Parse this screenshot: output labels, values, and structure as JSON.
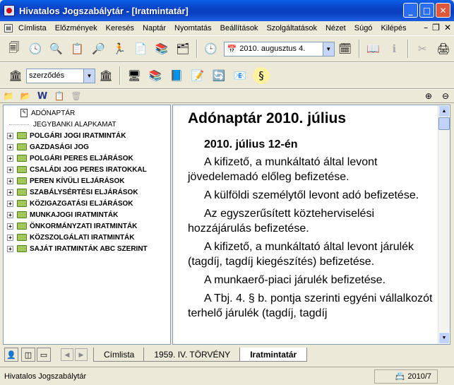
{
  "window": {
    "title": "Hivatalos Jogszabálytár - [Iratmintatár]",
    "minimize_label": "_",
    "maximize_label": "□",
    "close_label": "✕"
  },
  "menu": {
    "items": [
      "Címlista",
      "Előzmények",
      "Keresés",
      "Naptár",
      "Nyomtatás",
      "Beállítások",
      "Szolgáltatások",
      "Nézet",
      "Súgó",
      "Kilépés"
    ]
  },
  "toolbar1": {
    "date_value": "2010. augusztus 4."
  },
  "toolbar2": {
    "filter_value": "szerződés"
  },
  "tree": {
    "items": [
      {
        "label": "ADÓNAPTÁR",
        "type": "doc"
      },
      {
        "label": "JEGYBANKI ALAPKAMAT",
        "type": "leaf"
      },
      {
        "label": "POLGÁRI JOGI IRATMINTÁK",
        "type": "folder"
      },
      {
        "label": "GAZDASÁGI JOG",
        "type": "folder"
      },
      {
        "label": "POLGÁRI PERES ELJÁRÁSOK",
        "type": "folder"
      },
      {
        "label": "CSALÁDI JOG PERES IRATOKKAL",
        "type": "folder"
      },
      {
        "label": "PEREN KÍVÜLI ELJÁRÁSOK",
        "type": "folder"
      },
      {
        "label": "SZABÁLYSÉRTÉSI ELJÁRÁSOK",
        "type": "folder"
      },
      {
        "label": "KÖZIGAZGATÁSI ELJÁRÁSOK",
        "type": "folder"
      },
      {
        "label": "MUNKAJOGI IRATMINTÁK",
        "type": "folder"
      },
      {
        "label": "ÖNKORMÁNYZATI IRATMINTÁK",
        "type": "folder"
      },
      {
        "label": "KÖZSZOLGÁLATI IRATMINTÁK",
        "type": "folder"
      },
      {
        "label": "SAJÁT IRATMINTÁK ABC SZERINT",
        "type": "folder"
      }
    ]
  },
  "content": {
    "title": "Adónaptár 2010. július",
    "subtitle": "2010. július 12-én",
    "paragraphs": [
      "A kifizető, a munkáltató által levont jövedelemadó előleg befizetése.",
      "A külföldi személytől levont adó befizetése.",
      "Az egyszerűsített közteherviselési hozzájárulás befizetése.",
      "A kifizető, a munkáltató által levont járulék (tagdíj, tagdíj kiegészítés) befizetése.",
      "A munkaerő-piaci járulék befizetése.",
      "A Tbj. 4. § b. pontja szerinti egyéni vállalkozót terhelő járulék (tagdíj, tagdíj"
    ]
  },
  "tabs": [
    "Címlista",
    "1959. IV. TÖRVÉNY",
    "Iratmintatár"
  ],
  "active_tab": "Iratmintatár",
  "status": {
    "left": "Hivatalos Jogszabálytár",
    "right": "2010/7"
  }
}
